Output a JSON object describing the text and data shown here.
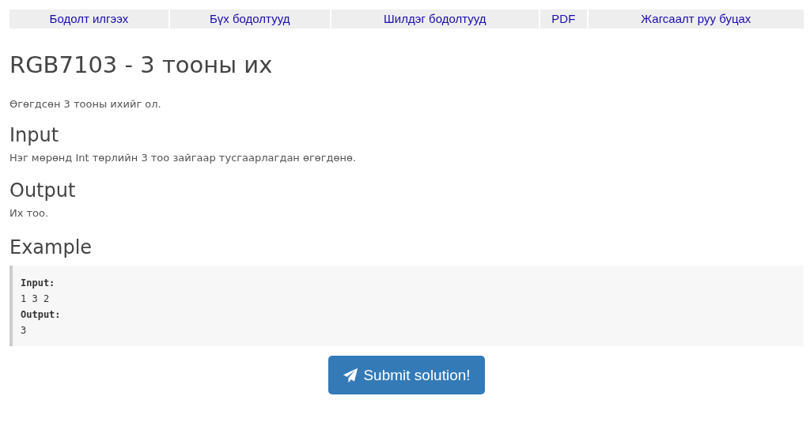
{
  "nav": [
    {
      "label": "Бодолт илгээх"
    },
    {
      "label": "Бүх бодолтууд"
    },
    {
      "label": "Шилдэг бодолтууд"
    },
    {
      "label": "PDF"
    },
    {
      "label": "Жагсаалт руу буцах"
    }
  ],
  "title": "RGB7103 - 3 тооны их",
  "statement": "Өгөгдсөн 3 тооны ихийг ол.",
  "sections": [
    {
      "heading": "Input",
      "text": "Нэг мөрөнд Int төрлийн 3 тоо зайгаар тусгаарлагдан өгөгдөнө."
    },
    {
      "heading": "Output",
      "text": "Их тоо."
    }
  ],
  "example": {
    "heading": "Example",
    "lines": [
      {
        "kind": "label",
        "text": "Input:"
      },
      {
        "kind": "value",
        "text": "1 3 2"
      },
      {
        "kind": "label",
        "text": "Output:"
      },
      {
        "kind": "value",
        "text": "3"
      }
    ]
  },
  "submit": {
    "label": "Submit solution!"
  }
}
